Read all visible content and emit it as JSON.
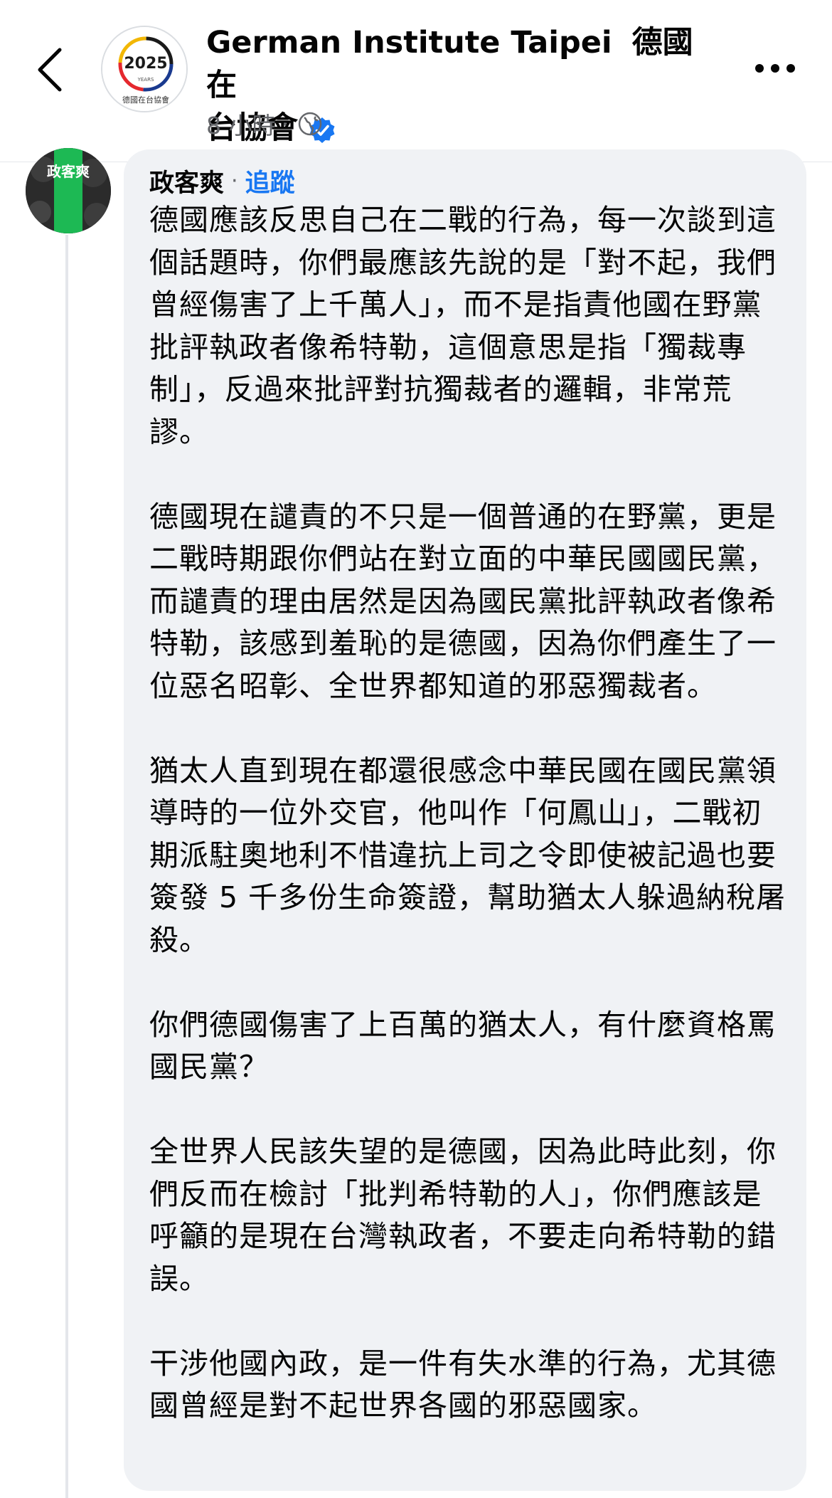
{
  "header": {
    "page_name_en": "German Institute Taipei",
    "page_name_zh_1": "德國在",
    "page_name_zh_2": "台協會",
    "time_ago": "8 小時",
    "separator": "·",
    "avatar_text_year": "2025",
    "avatar_text_years": "YEARS",
    "avatar_caption": "德國在台協會",
    "icons": {
      "back": "chevron-left-icon",
      "verified": "verified-badge-icon",
      "audience": "globe-icon",
      "more": "more-horizontal-icon"
    },
    "colors": {
      "verified": "#1877f2"
    }
  },
  "comment": {
    "avatar_text": "政客爽",
    "commenter_name": "政客爽",
    "separator": "·",
    "follow_label": "追蹤",
    "paragraphs": [
      "德國應該反思自己在二戰的行為，每一次談到這個話題時，你們最應該先說的是「對不起，我們曾經傷害了上千萬人」，而不是指責他國在野黨批評執政者像希特勒，這個意思是指「獨裁專制」，反過來批評對抗獨裁者的邏輯，非常荒謬。",
      "德國現在譴責的不只是一個普通的在野黨，更是二戰時期跟你們站在對立面的中華民國國民黨，而譴責的理由居然是因為國民黨批評執政者像希特勒，該感到羞恥的是德國，因為你們產生了一位惡名昭彰、全世界都知道的邪惡獨裁者。",
      "猶太人直到現在都還很感念中華民國在國民黨領導時的一位外交官，他叫作「何鳳山」，二戰初期派駐奧地利不惜違抗上司之令即使被記過也要簽發 5 千多份生命簽證，幫助猶太人躲過納稅屠殺。",
      "你們德國傷害了上百萬的猶太人，有什麼資格罵國民黨？",
      "全世界人民該失望的是德國，因為此時此刻，你們反而在檢討「批判希特勒的人」，你們應該是呼籲的是現在台灣執政者，不要走向希特勒的錯誤。",
      "干涉他國內政，是一件有失水準的行為，尤其德國曾經是對不起世界各國的邪惡國家。"
    ],
    "colors": {
      "follow": "#1877f2",
      "bubble": "#f0f2f5",
      "avatar_badge": "#1db954"
    }
  }
}
